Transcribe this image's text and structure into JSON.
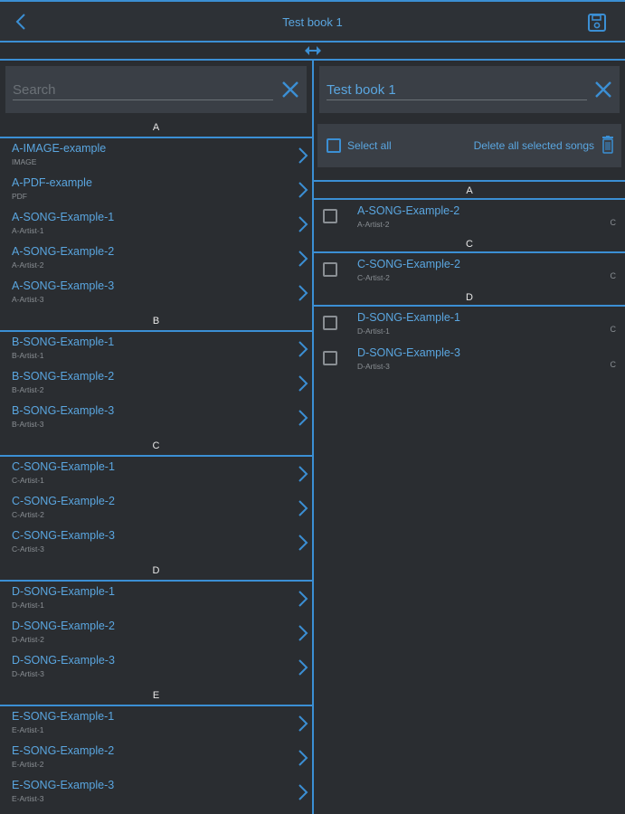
{
  "header": {
    "title": "Test book 1"
  },
  "left": {
    "search_placeholder": "Search",
    "sections": [
      {
        "letter": "A",
        "items": [
          {
            "title": "A-IMAGE-example",
            "subtitle": "IMAGE"
          },
          {
            "title": "A-PDF-example",
            "subtitle": "PDF"
          },
          {
            "title": "A-SONG-Example-1",
            "subtitle": "A-Artist-1"
          },
          {
            "title": "A-SONG-Example-2",
            "subtitle": "A-Artist-2"
          },
          {
            "title": "A-SONG-Example-3",
            "subtitle": "A-Artist-3"
          }
        ]
      },
      {
        "letter": "B",
        "items": [
          {
            "title": "B-SONG-Example-1",
            "subtitle": "B-Artist-1"
          },
          {
            "title": "B-SONG-Example-2",
            "subtitle": "B-Artist-2"
          },
          {
            "title": "B-SONG-Example-3",
            "subtitle": "B-Artist-3"
          }
        ]
      },
      {
        "letter": "C",
        "items": [
          {
            "title": "C-SONG-Example-1",
            "subtitle": "C-Artist-1"
          },
          {
            "title": "C-SONG-Example-2",
            "subtitle": "C-Artist-2"
          },
          {
            "title": "C-SONG-Example-3",
            "subtitle": "C-Artist-3"
          }
        ]
      },
      {
        "letter": "D",
        "items": [
          {
            "title": "D-SONG-Example-1",
            "subtitle": "D-Artist-1"
          },
          {
            "title": "D-SONG-Example-2",
            "subtitle": "D-Artist-2"
          },
          {
            "title": "D-SONG-Example-3",
            "subtitle": "D-Artist-3"
          }
        ]
      },
      {
        "letter": "E",
        "items": [
          {
            "title": "E-SONG-Example-1",
            "subtitle": "E-Artist-1"
          },
          {
            "title": "E-SONG-Example-2",
            "subtitle": "E-Artist-2"
          },
          {
            "title": "E-SONG-Example-3",
            "subtitle": "E-Artist-3"
          }
        ]
      }
    ]
  },
  "right": {
    "book_name_value": "Test book 1",
    "select_all_label": "Select all",
    "delete_label": "Delete all selected songs",
    "sections": [
      {
        "letter": "A",
        "items": [
          {
            "title": "A-SONG-Example-2",
            "subtitle": "A-Artist-2",
            "key": "C"
          }
        ]
      },
      {
        "letter": "C",
        "items": [
          {
            "title": "C-SONG-Example-2",
            "subtitle": "C-Artist-2",
            "key": "C"
          }
        ]
      },
      {
        "letter": "D",
        "items": [
          {
            "title": "D-SONG-Example-1",
            "subtitle": "D-Artist-1",
            "key": "C"
          },
          {
            "title": "D-SONG-Example-3",
            "subtitle": "D-Artist-3",
            "key": "C"
          }
        ]
      }
    ]
  },
  "colors": {
    "accent": "#3b8fd4",
    "text_primary": "#5aa6e0",
    "background": "#2a2d31",
    "panel": "#3a3f46"
  }
}
